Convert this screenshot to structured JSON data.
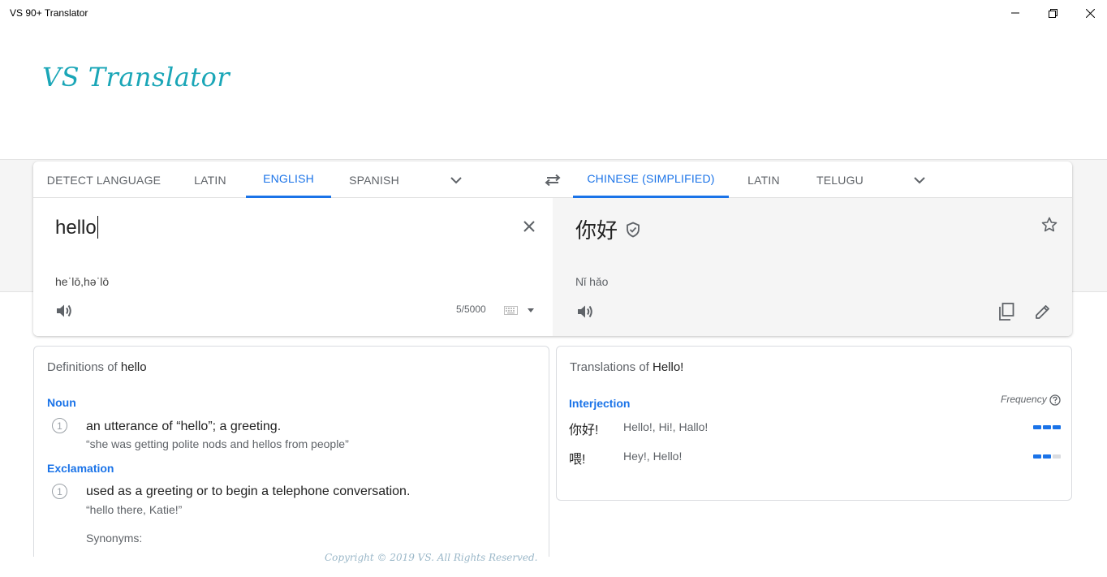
{
  "window": {
    "title": "VS 90+ Translator",
    "controls": [
      "minimize-icon",
      "restore-icon",
      "close-icon"
    ]
  },
  "logo": "VS Translator",
  "source_languages": {
    "tabs": [
      "DETECT LANGUAGE",
      "LATIN",
      "ENGLISH",
      "SPANISH"
    ],
    "active": "ENGLISH"
  },
  "target_languages": {
    "tabs": [
      "CHINESE (SIMPLIFIED)",
      "LATIN",
      "TELUGU"
    ],
    "active": "CHINESE (SIMPLIFIED)"
  },
  "source": {
    "text": "hello",
    "transliteration": "heˈlō,həˈlō",
    "char_count": "5/5000"
  },
  "target": {
    "text": "你好",
    "transliteration": "Nǐ hǎo"
  },
  "definitions": {
    "heading_prefix": "Definitions of",
    "word": "hello",
    "groups": [
      {
        "pos": "Noun",
        "entries": [
          {
            "num": "1",
            "gloss": "an utterance of “hello”; a greeting.",
            "example": "“she was getting polite nods and hellos from people”"
          }
        ]
      },
      {
        "pos": "Exclamation",
        "entries": [
          {
            "num": "1",
            "gloss": "used as a greeting or to begin a telephone conversation.",
            "example": "“hello there, Katie!”",
            "synonyms_label": "Synonyms:"
          }
        ]
      }
    ]
  },
  "translations": {
    "heading_prefix": "Translations of",
    "word": "Hello!",
    "pos": "Interjection",
    "frequency_label": "Frequency",
    "rows": [
      {
        "word": "你好!",
        "synonyms": "Hello!, Hi!, Hallo!",
        "frequency": 3
      },
      {
        "word": "喂!",
        "synonyms": "Hey!, Hello!",
        "frequency": 2
      }
    ]
  },
  "footer": "Copyright © 2019 VS. All Rights Reserved.",
  "colors": {
    "accent": "#1a73e8",
    "logo": "#1aa6b7",
    "target_pane": "#f5f5f5",
    "footer": "#9ab7c8"
  }
}
